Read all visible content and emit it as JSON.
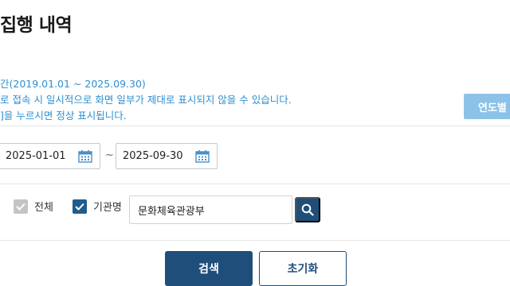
{
  "page": {
    "title": "집행 내역"
  },
  "notice": {
    "line1": "간(2019.01.01 ~ 2025.09.30)",
    "line2": "로 접속 시 일시적으로 화면 일부가 제대로 표시되지 않을 수 있습니다.",
    "line3": "]을 누르시면 정상 표시됩니다."
  },
  "yearly_button": {
    "label": "연도별"
  },
  "date_range": {
    "start": "2025-01-01",
    "separator": "~",
    "end": "2025-09-30"
  },
  "filters": {
    "all_label": "전체",
    "all_checked": true,
    "agency_label": "기관명",
    "agency_checked": true,
    "agency_value": "문화체육관광부"
  },
  "actions": {
    "search_label": "검색",
    "reset_label": "초기화"
  },
  "colors": {
    "primary": "#1f4e7a",
    "notice_text": "#2e8fd0",
    "yearly_button_bg": "#8cc2e8"
  },
  "icons": [
    "calendar-icon",
    "check-icon",
    "search-icon"
  ]
}
